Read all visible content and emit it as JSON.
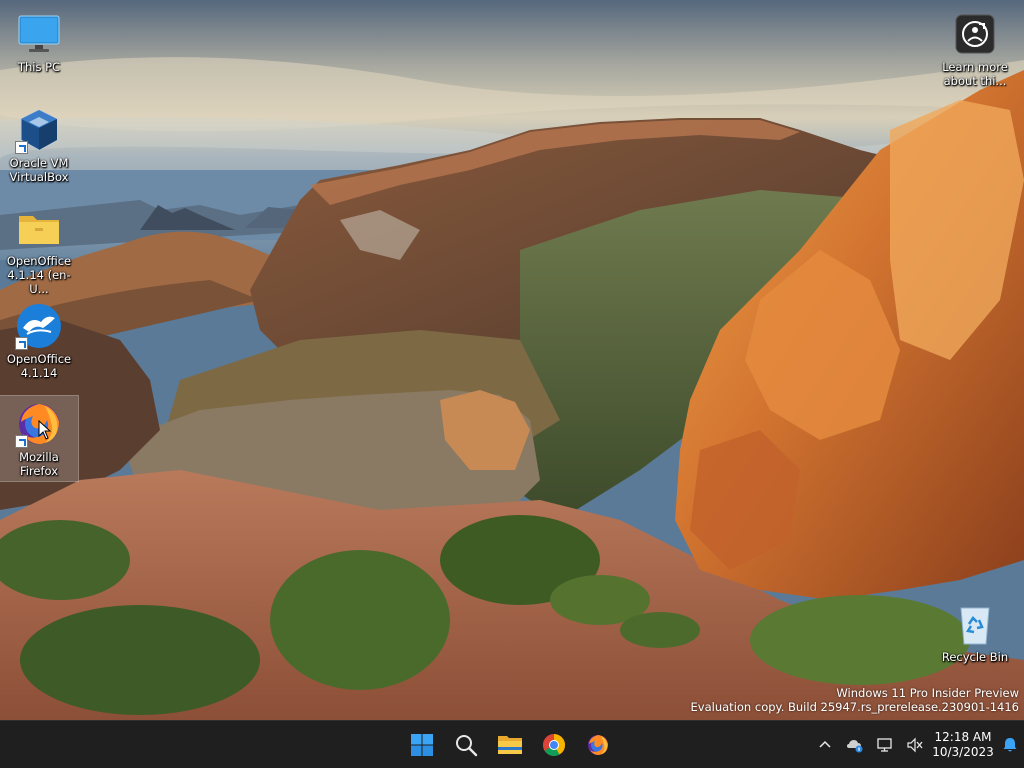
{
  "desktop": {
    "icons": [
      {
        "label": "This PC",
        "icon": "monitor-icon"
      },
      {
        "label": "Oracle VM VirtualBox",
        "icon": "virtualbox-icon"
      },
      {
        "label": "OpenOffice 4.1.14 (en-U...",
        "icon": "folder-icon"
      },
      {
        "label": "OpenOffice 4.1.14",
        "icon": "openoffice-icon"
      },
      {
        "label": "Mozilla Firefox",
        "icon": "firefox-icon"
      },
      {
        "label": "Learn more about thi...",
        "icon": "learn-more-icon"
      },
      {
        "label": "Recycle Bin",
        "icon": "recycle-bin-icon"
      }
    ]
  },
  "watermark": {
    "line1": "Windows 11 Pro Insider Preview",
    "line2": "Evaluation copy. Build 25947.rs_prerelease.230901-1416"
  },
  "taskbar": {
    "pinned": [
      "windows-start-icon",
      "search-icon",
      "file-explorer-icon",
      "chrome-icon",
      "firefox-icon"
    ],
    "tray": [
      "chevron-up-icon",
      "onedrive-icon",
      "network-icon",
      "volume-muted-icon",
      "notification-bell-icon"
    ],
    "clock": {
      "time": "12:18 AM",
      "date": "10/3/2023"
    }
  },
  "colors": {
    "taskbar": "#1f1f1f",
    "accent": "#0a84ff"
  }
}
